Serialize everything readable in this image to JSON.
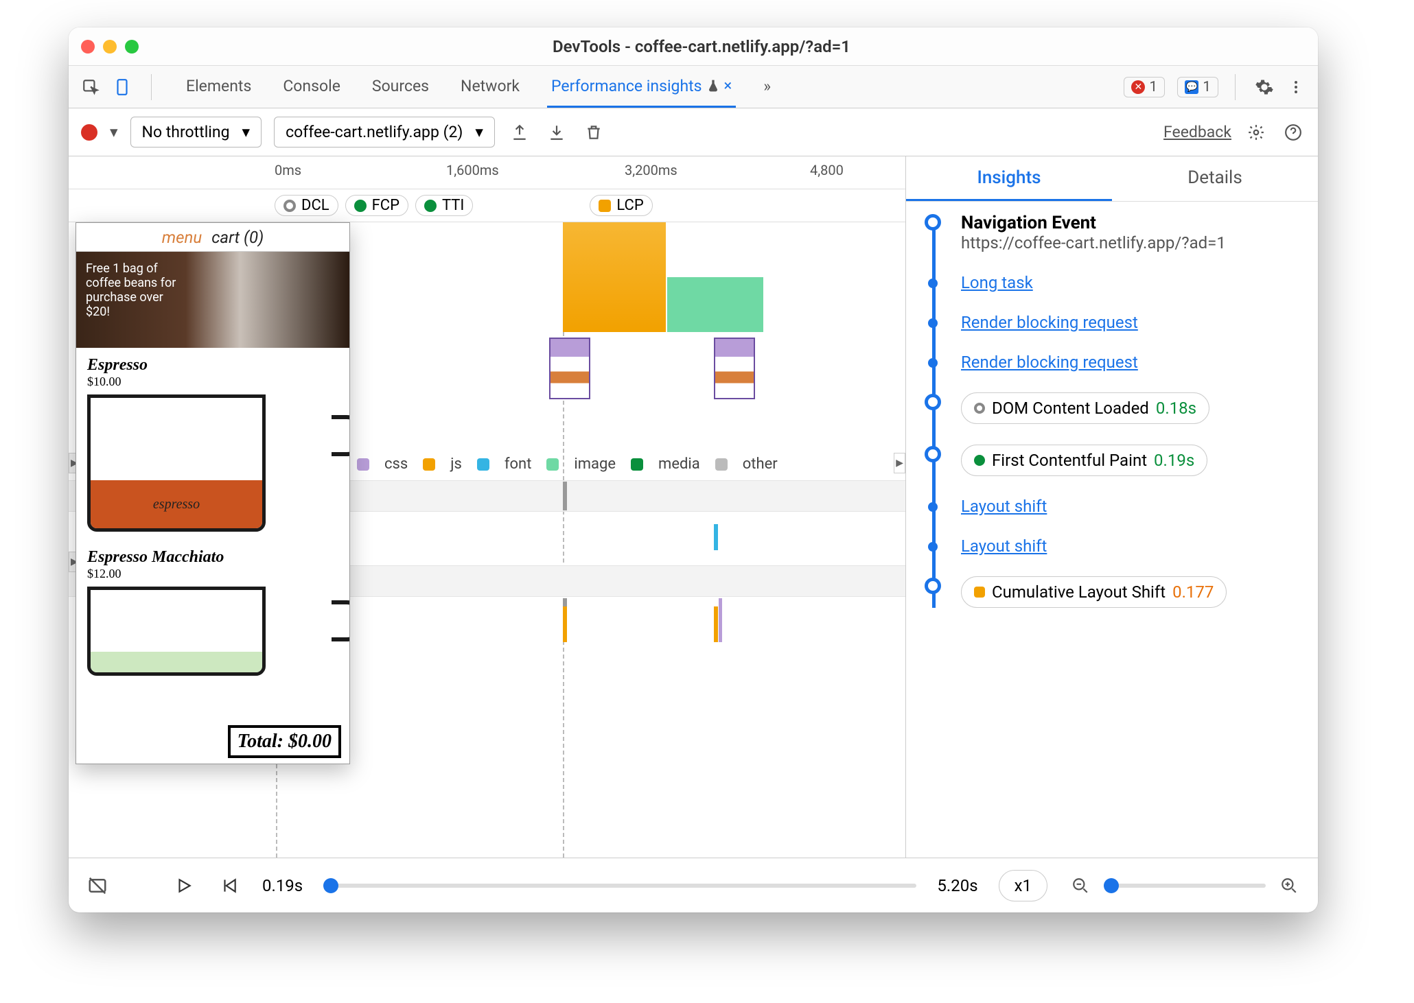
{
  "window": {
    "title": "DevTools - coffee-cart.netlify.app/?ad=1"
  },
  "tabs": {
    "elements": "Elements",
    "console": "Console",
    "sources": "Sources",
    "network": "Network",
    "performance_insights": "Performance insights",
    "errors_count": "1",
    "info_count": "1"
  },
  "toolbar": {
    "throttling": "No throttling",
    "recording_select": "coffee-cart.netlify.app (2)",
    "feedback": "Feedback"
  },
  "ruler": {
    "t0": "0ms",
    "t1": "1,600ms",
    "t2": "3,200ms",
    "t3": "4,800"
  },
  "markers": {
    "dcl": "DCL",
    "fcp": "FCP",
    "tti": "TTI",
    "lcp": "LCP"
  },
  "legend": {
    "css": "css",
    "js": "js",
    "font": "font",
    "image": "image",
    "media": "media",
    "other": "other"
  },
  "preview": {
    "menu": "menu",
    "cart": "cart (0)",
    "banner": "Free 1 bag of coffee beans for purchase over $20!",
    "p1_name": "Espresso",
    "p1_price": "$10.00",
    "p1_label": "espresso",
    "p2_name": "Espresso Macchiato",
    "p2_price": "$12.00",
    "total": "Total: $0.00"
  },
  "insights_tabs": {
    "insights": "Insights",
    "details": "Details"
  },
  "insights": {
    "nav_title": "Navigation Event",
    "nav_url": "https://coffee-cart.netlify.app/?ad=1",
    "long_task": "Long task",
    "rbr": "Render blocking request",
    "dcl_label": "DOM Content Loaded",
    "dcl_val": "0.18s",
    "fcp_label": "First Contentful Paint",
    "fcp_val": "0.19s",
    "ls": "Layout shift",
    "cls_label": "Cumulative Layout Shift",
    "cls_val": "0.177"
  },
  "footer": {
    "t_start": "0.19s",
    "t_end": "5.20s",
    "speed": "x1"
  }
}
